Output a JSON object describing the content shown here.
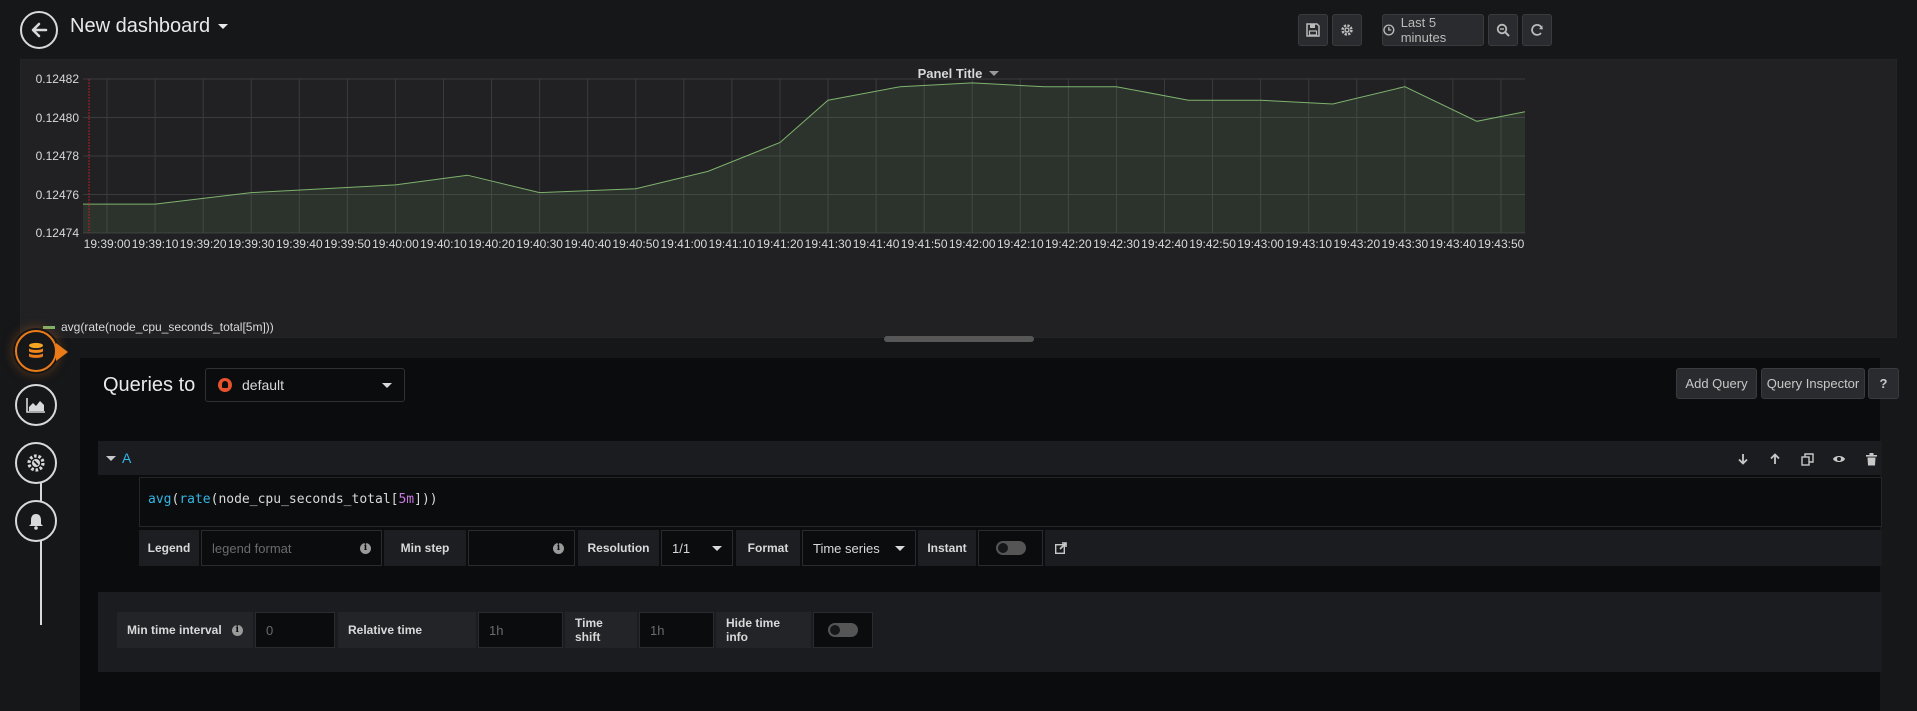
{
  "header": {
    "title": "New dashboard",
    "time_range_label": "Last 5 minutes"
  },
  "panel": {
    "title": "Panel Title"
  },
  "chart_data": {
    "type": "area",
    "title": "Panel Title",
    "x": [
      "19:38:55",
      "19:39:10",
      "19:39:30",
      "19:40:00",
      "19:40:15",
      "19:40:30",
      "19:40:50",
      "19:41:05",
      "19:41:20",
      "19:41:30",
      "19:41:45",
      "19:42:00",
      "19:42:15",
      "19:42:30",
      "19:42:45",
      "19:43:00",
      "19:43:15",
      "19:43:30",
      "19:43:45",
      "19:43:55"
    ],
    "series": [
      {
        "name": "avg(rate(node_cpu_seconds_total[5m]))",
        "color": "#7eb26d",
        "values": [
          0.124755,
          0.124755,
          0.124761,
          0.124765,
          0.12477,
          0.124761,
          0.124763,
          0.124772,
          0.124787,
          0.124809,
          0.124816,
          0.124818,
          0.124816,
          0.124816,
          0.124809,
          0.124809,
          0.124807,
          0.124816,
          0.124798,
          0.124803
        ]
      }
    ],
    "ylim": [
      0.12474,
      0.12482
    ],
    "yticks": [
      "0.12482",
      "0.12480",
      "0.12478",
      "0.12476",
      "0.12474"
    ],
    "xticks": [
      "19:39:00",
      "19:39:10",
      "19:39:20",
      "19:39:30",
      "19:39:40",
      "19:39:50",
      "19:40:00",
      "19:40:10",
      "19:40:20",
      "19:40:30",
      "19:40:40",
      "19:40:50",
      "19:41:00",
      "19:41:10",
      "19:41:20",
      "19:41:30",
      "19:41:40",
      "19:41:50",
      "19:42:00",
      "19:42:10",
      "19:42:20",
      "19:42:30",
      "19:42:40",
      "19:42:50",
      "19:43:00",
      "19:43:10",
      "19:43:20",
      "19:43:30",
      "19:43:40",
      "19:43:50"
    ],
    "grid": true,
    "legend": "bottom-left"
  },
  "query_editor": {
    "queries_to_label": "Queries to",
    "datasource": "default",
    "add_query_label": "Add Query",
    "query_inspector_label": "Query Inspector",
    "help_label": "?",
    "query_letter": "A",
    "expr": {
      "fn1": "avg",
      "fn2": "rate",
      "metric": "node_cpu_seconds_total",
      "range": "5m"
    },
    "legend_label": "Legend",
    "legend_placeholder": "legend format",
    "min_step_label": "Min step",
    "resolution_label": "Resolution",
    "resolution_value": "1/1",
    "format_label": "Format",
    "format_value": "Time series",
    "instant_label": "Instant"
  },
  "options": {
    "min_time_interval_label": "Min time interval",
    "min_time_interval_placeholder": "0",
    "relative_time_label": "Relative time",
    "relative_time_placeholder": "1h",
    "time_shift_label": "Time shift",
    "time_shift_placeholder": "1h",
    "hide_time_info_label": "Hide time info"
  }
}
